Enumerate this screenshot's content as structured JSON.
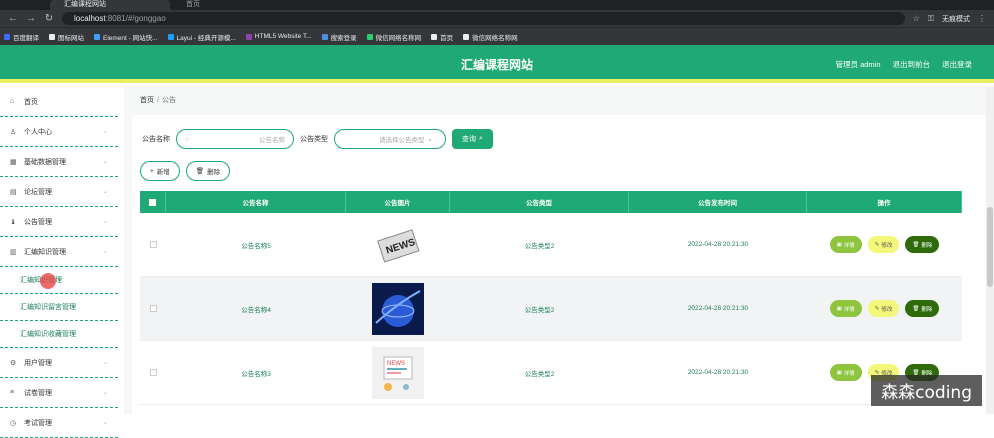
{
  "browser": {
    "tab_title": "汇编课程网站",
    "tab2_title": "首页",
    "url_host": "localhost",
    "url_rest": ":8081/#/gonggao",
    "incognito_label": "无痕模式"
  },
  "bookmarks": [
    {
      "label": "百度翻译",
      "color": "#3b6cf6"
    },
    {
      "label": "图标网站",
      "color": "#e8eaed"
    },
    {
      "label": "Element - 网站快...",
      "color": "#409eff"
    },
    {
      "label": "Layui - 经典开源模...",
      "color": "#1e9fff"
    },
    {
      "label": "HTML5 Website T...",
      "color": "#8e44ad"
    },
    {
      "label": "搜索登录",
      "color": "#4a90e2"
    },
    {
      "label": "微信网络名称网",
      "color": "#2ecc71"
    },
    {
      "label": "首页",
      "color": "#e8eaed"
    },
    {
      "label": "微信网络名称网",
      "color": "#e8eaed"
    }
  ],
  "header": {
    "title": "汇编课程网站",
    "links": [
      "管理员 admin",
      "退出到前台",
      "退出登录"
    ]
  },
  "sidebar": {
    "items": [
      {
        "label": "首页",
        "icon": "home-icon",
        "chev": false
      },
      {
        "label": "个人中心",
        "icon": "user-icon",
        "chev": true
      },
      {
        "label": "基础数据管理",
        "icon": "grid-icon",
        "chev": true
      },
      {
        "label": "论坛管理",
        "icon": "forum-icon",
        "chev": true
      },
      {
        "label": "公告管理",
        "icon": "bell-icon",
        "chev": true
      },
      {
        "label": "汇编知识管理",
        "icon": "book-icon",
        "chev": true
      }
    ],
    "subitems": [
      "汇编知识管理",
      "汇编知识留言管理",
      "汇编知识收藏管理"
    ],
    "items_after": [
      {
        "label": "用户管理",
        "icon": "users-icon",
        "chev": true
      },
      {
        "label": "试卷管理",
        "icon": "paper-icon",
        "chev": true
      },
      {
        "label": "考试管理",
        "icon": "exam-icon",
        "chev": true
      }
    ]
  },
  "breadcrumb": {
    "home": "首页",
    "sep": "/",
    "current": "公告"
  },
  "search": {
    "name_label": "公告名称",
    "name_placeholder": "公告名称",
    "type_label": "公告类型",
    "type_placeholder": "请选择公告类型",
    "button": "查询"
  },
  "actions": {
    "add": "新增",
    "delete": "删除"
  },
  "table": {
    "headers": [
      "公告名称",
      "公告图片",
      "公告类型",
      "公告发布时间",
      "操作"
    ],
    "rows": [
      {
        "name": "公告名称5",
        "image": "news-paper-image",
        "type": "公告类型2",
        "time": "2022-04-28 20:21:30"
      },
      {
        "name": "公告名称4",
        "image": "globe-image",
        "type": "公告类型2",
        "time": "2022-04-28 20:21:30"
      },
      {
        "name": "公告名称3",
        "image": "news-board-image",
        "type": "公告类型2",
        "time": "2022-04-28 20:21:30"
      }
    ],
    "op_labels": {
      "detail": "详情",
      "edit": "修改",
      "delete": "删除"
    }
  },
  "watermark": "森森coding",
  "colors": {
    "primary": "#1fa976",
    "accent_yellow": "#e8f060"
  }
}
